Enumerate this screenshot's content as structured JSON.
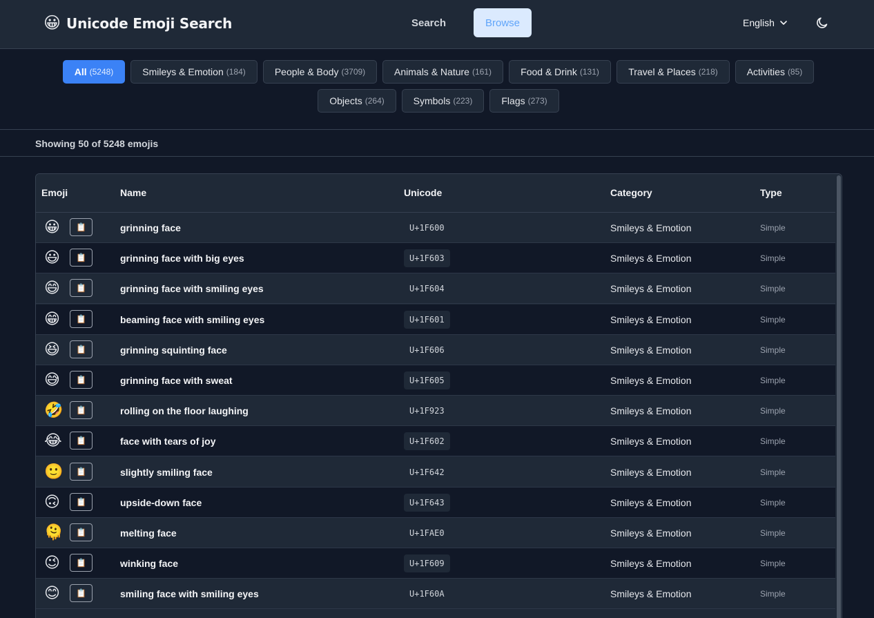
{
  "header": {
    "brand_emoji": "😀",
    "title": "Unicode Emoji Search",
    "nav_search": "Search",
    "nav_browse": "Browse",
    "language": "English"
  },
  "filters": [
    {
      "label": "All",
      "count": "(5248)",
      "active": true
    },
    {
      "label": "Smileys & Emotion",
      "count": "(184)"
    },
    {
      "label": "People & Body",
      "count": "(3709)"
    },
    {
      "label": "Animals & Nature",
      "count": "(161)"
    },
    {
      "label": "Food & Drink",
      "count": "(131)"
    },
    {
      "label": "Travel & Places",
      "count": "(218)"
    },
    {
      "label": "Activities",
      "count": "(85)"
    },
    {
      "label": "Objects",
      "count": "(264)"
    },
    {
      "label": "Symbols",
      "count": "(223)"
    },
    {
      "label": "Flags",
      "count": "(273)"
    }
  ],
  "status": "Showing 50 of 5248 emojis",
  "table": {
    "columns": [
      "Emoji",
      "Name",
      "Unicode",
      "Category",
      "Type"
    ],
    "copy_icon": "📋",
    "rows": [
      {
        "emoji": "😀",
        "name": "grinning face",
        "code": "U+1F600",
        "category": "Smileys & Emotion",
        "type": "Simple"
      },
      {
        "emoji": "😃",
        "name": "grinning face with big eyes",
        "code": "U+1F603",
        "category": "Smileys & Emotion",
        "type": "Simple"
      },
      {
        "emoji": "😄",
        "name": "grinning face with smiling eyes",
        "code": "U+1F604",
        "category": "Smileys & Emotion",
        "type": "Simple"
      },
      {
        "emoji": "😁",
        "name": "beaming face with smiling eyes",
        "code": "U+1F601",
        "category": "Smileys & Emotion",
        "type": "Simple"
      },
      {
        "emoji": "😆",
        "name": "grinning squinting face",
        "code": "U+1F606",
        "category": "Smileys & Emotion",
        "type": "Simple"
      },
      {
        "emoji": "😅",
        "name": "grinning face with sweat",
        "code": "U+1F605",
        "category": "Smileys & Emotion",
        "type": "Simple"
      },
      {
        "emoji": "🤣",
        "name": "rolling on the floor laughing",
        "code": "U+1F923",
        "category": "Smileys & Emotion",
        "type": "Simple"
      },
      {
        "emoji": "😂",
        "name": "face with tears of joy",
        "code": "U+1F602",
        "category": "Smileys & Emotion",
        "type": "Simple"
      },
      {
        "emoji": "🙂",
        "name": "slightly smiling face",
        "code": "U+1F642",
        "category": "Smileys & Emotion",
        "type": "Simple"
      },
      {
        "emoji": "🙃",
        "name": "upside-down face",
        "code": "U+1F643",
        "category": "Smileys & Emotion",
        "type": "Simple"
      },
      {
        "emoji": "🫠",
        "name": "melting face",
        "code": "U+1FAE0",
        "category": "Smileys & Emotion",
        "type": "Simple"
      },
      {
        "emoji": "😉",
        "name": "winking face",
        "code": "U+1F609",
        "category": "Smileys & Emotion",
        "type": "Simple"
      },
      {
        "emoji": "😊",
        "name": "smiling face with smiling eyes",
        "code": "U+1F60A",
        "category": "Smileys & Emotion",
        "type": "Simple"
      }
    ]
  },
  "colors": {
    "background": "#111827",
    "header": "#1f2937",
    "accent": "#3b82f6",
    "browse_bg": "#dbeafe",
    "browse_text": "#60a5fa"
  }
}
